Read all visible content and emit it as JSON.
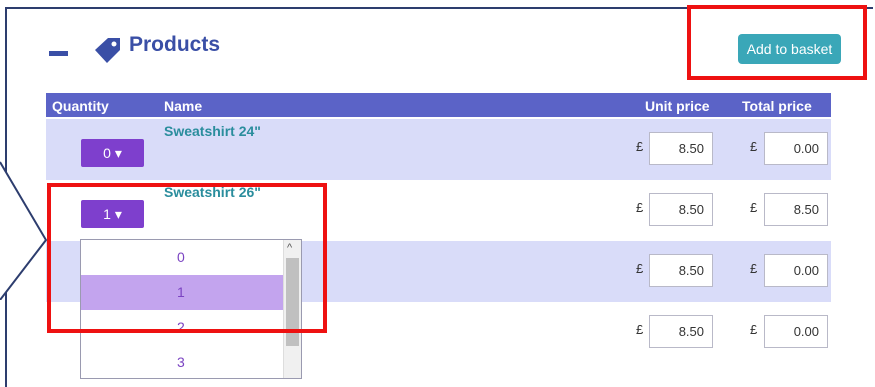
{
  "section": {
    "title": "Products",
    "add_button_label": "Add to basket"
  },
  "table": {
    "headers": {
      "quantity": "Quantity",
      "name": "Name",
      "unit_price": "Unit price",
      "total_price": "Total price"
    },
    "currency_symbol": "£",
    "rows": [
      {
        "qty_label": "0 ▾",
        "name": "Sweatshirt 24\"",
        "unit_price": "8.50",
        "total_price": "0.00"
      },
      {
        "qty_label": "1 ▾",
        "name": "Sweatshirt 26\"",
        "unit_price": "8.50",
        "total_price": "8.50"
      },
      {
        "qty_label": "",
        "name": "",
        "unit_price": "8.50",
        "total_price": "0.00"
      },
      {
        "qty_label": "",
        "name": "",
        "unit_price": "8.50",
        "total_price": "0.00"
      }
    ]
  },
  "dropdown": {
    "options": [
      "0",
      "1",
      "2",
      "3"
    ],
    "selected": "1"
  },
  "colors": {
    "accent": "#3a4fa6",
    "header_bg": "#5b63c7",
    "qty_button": "#7e3fcd",
    "highlight_red": "#ee1111",
    "add_button": "#3aa7b8"
  },
  "icons": {
    "collapse": "minus-icon",
    "tag": "tag-icon"
  }
}
